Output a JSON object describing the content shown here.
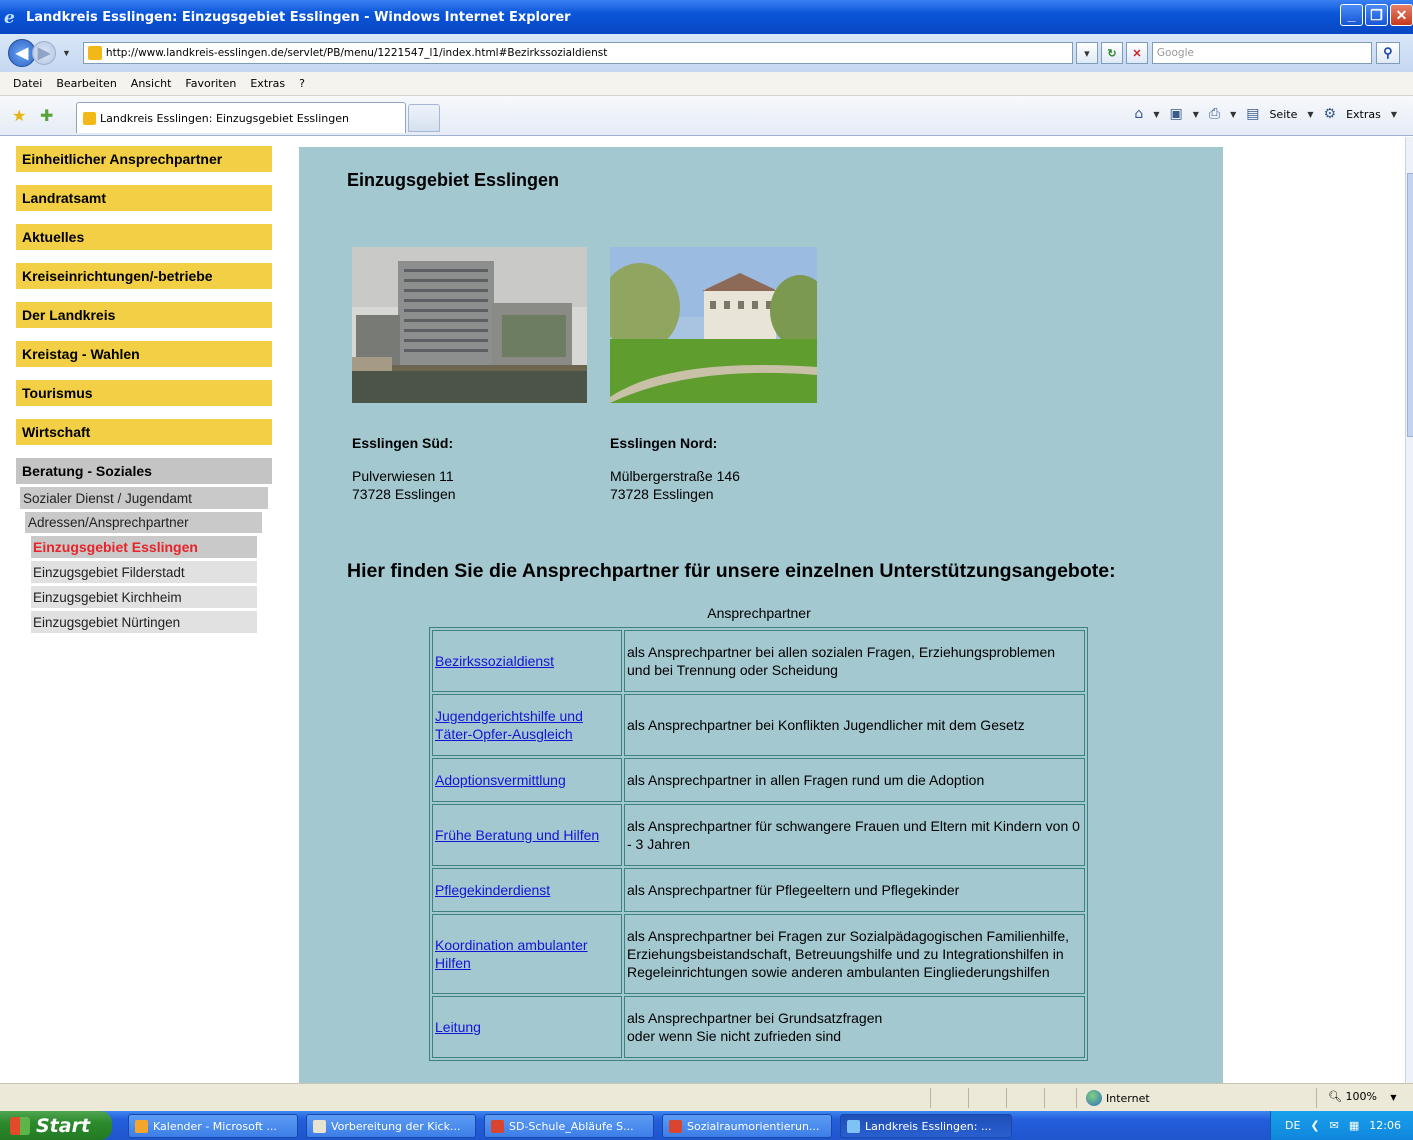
{
  "window": {
    "title": "Landkreis Esslingen: Einzugsgebiet Esslingen - Windows Internet Explorer",
    "min": "_",
    "max": "❐",
    "close": "✕"
  },
  "address": {
    "url": "http://www.landkreis-esslingen.de/servlet/PB/menu/1221547_l1/index.html#Bezirkssozialdienst",
    "search_placeholder": "Google"
  },
  "menu": [
    "Datei",
    "Bearbeiten",
    "Ansicht",
    "Favoriten",
    "Extras",
    "?"
  ],
  "tab": {
    "label": "Landkreis Esslingen: Einzugsgebiet Esslingen"
  },
  "commandbar": {
    "page": "Seite",
    "tools": "Extras"
  },
  "nav": {
    "items": [
      "Einheitlicher Ansprechpartner",
      "Landratsamt",
      "Aktuelles",
      "Kreiseinrichtungen/-betriebe",
      "Der Landkreis",
      "Kreistag - Wahlen",
      "Tourismus",
      "Wirtschaft"
    ],
    "active": "Beratung - Soziales",
    "sub1": "Sozialer Dienst / Jugendamt",
    "sub2": "Adressen/Ansprechpartner",
    "sub3": [
      "Einzugsgebiet Esslingen",
      "Einzugsgebiet Filderstadt",
      "Einzugsgebiet Kirchheim",
      "Einzugsgebiet Nürtingen"
    ]
  },
  "content": {
    "title": "Einzugsgebiet Esslingen",
    "offices": [
      {
        "head": "Esslingen Süd:",
        "street": "Pulverwiesen 11",
        "city": "73728 Esslingen"
      },
      {
        "head": "Esslingen Nord:",
        "street": "Mülbergerstraße 146",
        "city": "73728 Esslingen"
      }
    ],
    "subtitle": "Hier finden Sie die Ansprechpartner für unsere einzelnen Unterstützungsangebote:",
    "table_caption": "Ansprechpartner",
    "rows": [
      {
        "link": "Bezirkssozialdienst",
        "desc": "als Ansprechpartner bei allen sozialen Fragen, Erziehungsproblemen und bei Trennung oder Scheidung"
      },
      {
        "link": "Jugendgerichtshilfe und Täter-Opfer-Ausgleich",
        "desc": "als Ansprechpartner bei Konflikten Jugendlicher mit dem Gesetz"
      },
      {
        "link": "Adoptionsvermittlung",
        "desc": "als Ansprechpartner in allen Fragen rund um die Adoption"
      },
      {
        "link": "Frühe Beratung und Hilfen",
        "desc": "als Ansprechpartner für schwangere Frauen und Eltern mit Kindern von 0 - 3 Jahren"
      },
      {
        "link": "Pflegekinderdienst",
        "desc": "als Ansprechpartner für Pflegeeltern und Pflegekinder"
      },
      {
        "link": "Koordination ambulanter Hilfen",
        "desc": "als Ansprechpartner bei Fragen zur Sozialpädagogischen Familienhilfe, Erziehungsbeistandschaft, Betreuungshilfe und zu Integrationshilfen in Regeleinrichtungen sowie anderen ambulanten Eingliederungshilfen"
      },
      {
        "link": "Leitung",
        "desc": "als Ansprechpartner bei Grundsatzfragen\noder wenn Sie nicht zufrieden sind"
      }
    ]
  },
  "status": {
    "zone": "Internet",
    "zoom": "100%"
  },
  "taskbar": {
    "start": "Start",
    "tasks": [
      "Kalender - Microsoft ...",
      "Vorbereitung der Kick...",
      "SD-Schule_Abläufe S...",
      "Sozialraumorientierun...",
      "Landkreis Esslingen: ..."
    ],
    "lang": "DE",
    "time": "12:06"
  }
}
